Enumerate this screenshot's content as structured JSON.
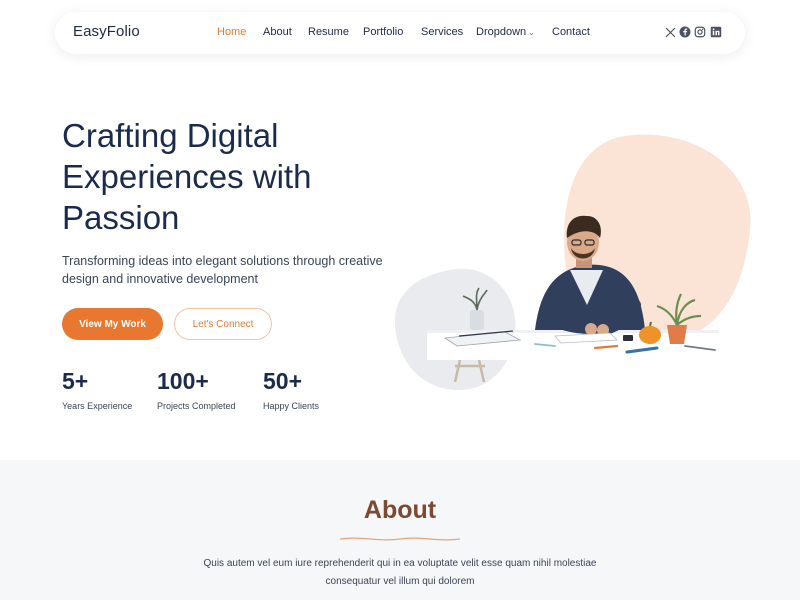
{
  "header": {
    "logo": "EasyFolio",
    "nav": [
      {
        "label": "Home",
        "active": true
      },
      {
        "label": "About"
      },
      {
        "label": "Resume"
      },
      {
        "label": "Portfolio"
      },
      {
        "label": "Services"
      },
      {
        "label": "Dropdown"
      },
      {
        "label": "Contact"
      }
    ],
    "socials": [
      "x-icon",
      "facebook-icon",
      "instagram-icon",
      "linkedin-icon"
    ]
  },
  "hero": {
    "title_lines": [
      "Crafting Digital",
      "Experiences with",
      "Passion"
    ],
    "subtitle": "Transforming ideas into elegant solutions through creative design and innovative development",
    "primary_button": "View My Work",
    "secondary_button": "Let's Connect",
    "stats": [
      {
        "value": "5+",
        "label": "Years Experience"
      },
      {
        "value": "100+",
        "label": "Projects Completed"
      },
      {
        "value": "50+",
        "label": "Happy Clients"
      }
    ]
  },
  "about": {
    "title": "About",
    "text": "Quis autem vel eum iure reprehenderit qui in ea voluptate velit esse quam nihil molestiae consequatur vel illum qui dolorem"
  },
  "colors": {
    "accent": "#e8782f",
    "heading": "#1a2b4c",
    "about_title": "#7a4a33",
    "blob_peach": "#fbe3d6",
    "blob_gray": "#e9ebee",
    "section_bg": "#f6f7f9"
  }
}
